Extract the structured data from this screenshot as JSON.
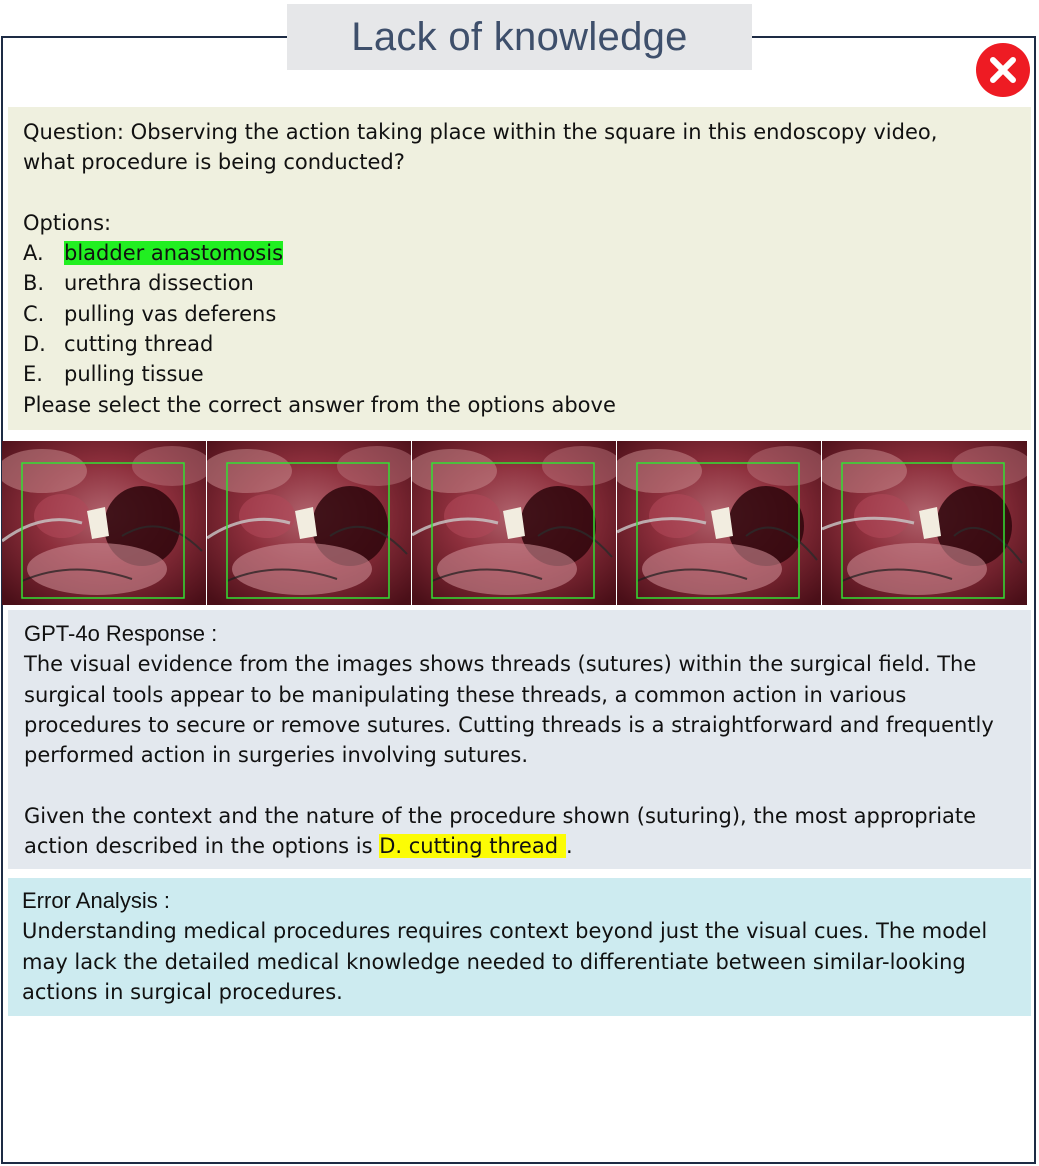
{
  "title": "Lack of knowledge",
  "status_icon": "close-icon",
  "colors": {
    "frame_border": "#1d2b44",
    "title_bg": "#e6e7e9",
    "title_text": "#3e4f6b",
    "question_bg": "#eff0df",
    "response_bg": "#e3e8ee",
    "error_bg": "#cdebf0",
    "correct_highlight": "#21ef21",
    "model_highlight": "#fcfc05",
    "wrong_icon": "#ee1b23"
  },
  "question": {
    "line1": "Question: Observing the action taking place within the square in this endoscopy video,",
    "line2": "what procedure is being conducted?",
    "options_label": "Options:",
    "options": [
      {
        "letter": "A.",
        "text": "bladder anastomosis",
        "correct": true
      },
      {
        "letter": "B.",
        "text": "urethra dissection"
      },
      {
        "letter": "C.",
        "text": "pulling vas deferens"
      },
      {
        "letter": "D.",
        "text": "cutting thread"
      },
      {
        "letter": "E.",
        "text": "pulling tissue"
      }
    ],
    "instruction": "Please select the correct answer from the options above"
  },
  "video_frames": [
    "endoscopy-frame",
    "endoscopy-frame",
    "endoscopy-frame",
    "endoscopy-frame",
    "endoscopy-frame"
  ],
  "response": {
    "heading": "GPT-4o Response :",
    "p1": [
      "The visual evidence from the images shows threads (sutures) within the surgical field. The",
      "surgical tools appear to be manipulating these threads, a common action in various",
      "procedures to secure or remove sutures. Cutting threads is a straightforward and frequently",
      "performed action in surgeries involving sutures."
    ],
    "p2_line1": "Given the context and the nature of the procedure shown (suturing), the most appropriate",
    "p2_line2_prefix": "action described in the options is",
    "answer": "D. cutting thread",
    "p2_line2_suffix": "."
  },
  "error_analysis": {
    "heading": "Error Analysis :",
    "lines": [
      "Understanding medical procedures requires context beyond just the visual cues. The model",
      "may lack the detailed medical knowledge needed to differentiate between similar-looking",
      "actions in surgical procedures."
    ]
  }
}
